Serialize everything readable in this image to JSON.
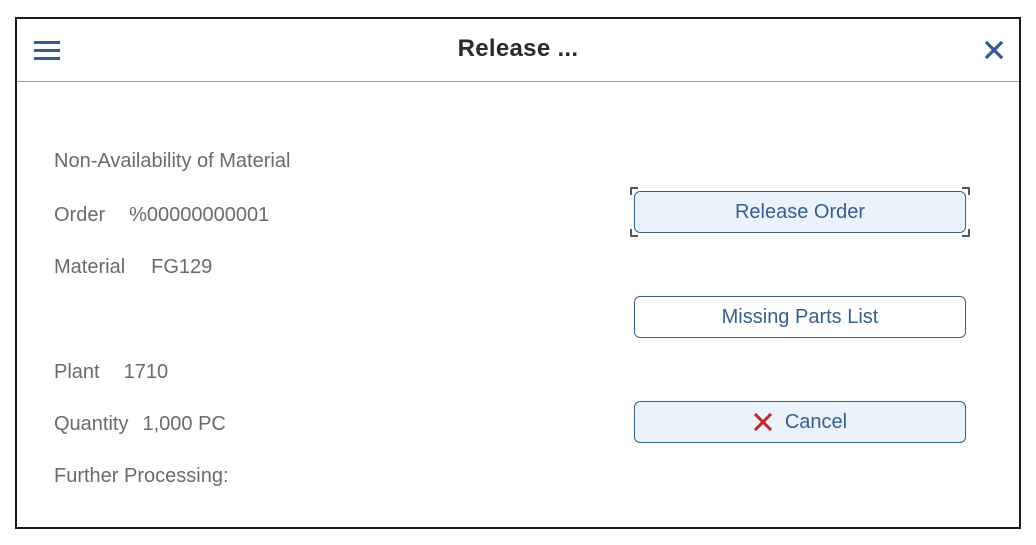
{
  "dialog": {
    "title": "Release ...",
    "menu_icon": "hamburger-menu-icon",
    "close_icon": "close-icon"
  },
  "info": {
    "heading": "Non-Availability of Material",
    "order_label": "Order",
    "order_value": "%00000000001",
    "material_label": "Material",
    "material_value": "FG129",
    "plant_label": "Plant",
    "plant_value": "1710",
    "quantity_label": "Quantity",
    "quantity_value": "1,000 PC",
    "further_processing": "Further Processing:"
  },
  "actions": {
    "release_order": "Release Order",
    "missing_parts_list": "Missing Parts List",
    "cancel": "Cancel",
    "cancel_icon": "cancel-x-icon"
  },
  "colors": {
    "accent": "#355f8c",
    "button_fill": "#eaf3fb",
    "cancel_icon": "#c0262d",
    "text": "#6a6a6a"
  }
}
